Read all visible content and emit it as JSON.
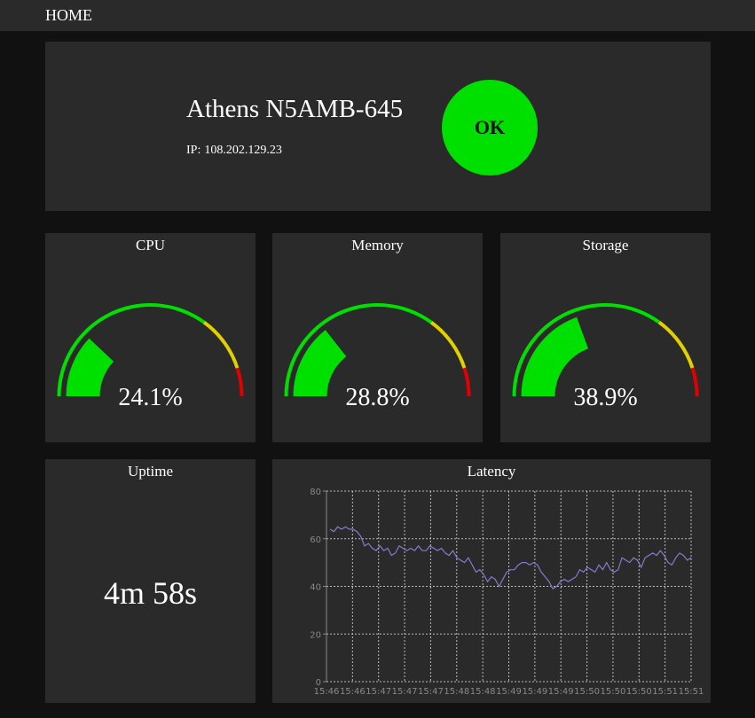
{
  "nav": {
    "home_label": "HOME"
  },
  "device": {
    "name": "Athens N5AMB-645",
    "ip_label": "IP:",
    "ip": "108.202.129.23",
    "status": "OK",
    "status_color": "#00e000"
  },
  "gauges": [
    {
      "title": "CPU",
      "value": 24.1,
      "display": "24.1%"
    },
    {
      "title": "Memory",
      "value": 28.8,
      "display": "28.8%"
    },
    {
      "title": "Storage",
      "value": 38.9,
      "display": "38.9%"
    }
  ],
  "gauge_colors": {
    "ok": "#00e000",
    "warn": "#e0d000",
    "crit": "#e00000",
    "bands": [
      0,
      70,
      90,
      100
    ]
  },
  "uptime": {
    "title": "Uptime",
    "value": "4m 58s"
  },
  "latency": {
    "title": "Latency",
    "chart_data": {
      "type": "line",
      "title": "Latency",
      "xlabel": "",
      "ylabel": "",
      "ylim": [
        0,
        80
      ],
      "yticks": [
        0,
        20,
        40,
        60,
        80
      ],
      "xtick_labels": [
        "15:46",
        "15:46",
        "15:47",
        "15:47",
        "15:47",
        "15:48",
        "15:48",
        "15:49",
        "15:49",
        "15:49",
        "15:50",
        "15:50",
        "15:50",
        "15:51",
        "15:51"
      ],
      "grid": true,
      "line_color": "#8877cc",
      "series": [
        {
          "values": [
            64,
            63,
            65,
            64,
            65,
            64,
            64,
            63,
            61,
            57,
            58,
            56,
            55,
            57,
            55,
            56,
            53,
            54,
            57,
            56,
            55,
            56,
            55,
            57,
            55,
            55,
            57,
            56,
            55,
            56,
            54,
            53,
            55,
            52,
            51,
            50,
            52,
            49,
            46,
            47,
            45,
            42,
            44,
            43,
            40,
            43,
            46,
            47,
            47,
            49,
            50,
            50,
            49,
            50,
            49,
            46,
            44,
            42,
            39,
            40,
            42,
            43,
            42,
            43,
            44,
            47,
            46,
            48,
            47,
            46,
            49,
            47,
            50,
            47,
            46,
            47,
            52,
            51,
            50,
            52,
            51,
            48,
            52,
            53,
            54,
            53,
            55,
            53,
            50,
            49,
            52,
            54,
            53,
            51,
            52
          ]
        }
      ]
    }
  }
}
